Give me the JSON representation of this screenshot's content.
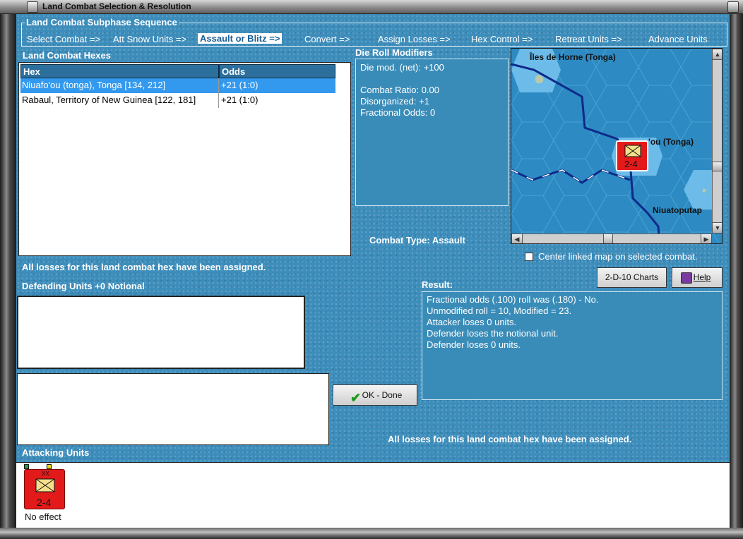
{
  "window": {
    "title": "Land Combat Selection & Resolution"
  },
  "subphase": {
    "title": "Land Combat Subphase Sequence",
    "steps": [
      "Select Combat =>",
      "Att Snow Units =>",
      "Assault or Blitz =>",
      "Convert =>",
      "Assign Losses =>",
      "Hex Control =>",
      "Retreat Units =>",
      "Advance Units"
    ],
    "active_step": "Assault or Blitz =>"
  },
  "hexes": {
    "title": "Land Combat Hexes",
    "columns": [
      "Hex",
      "Odds"
    ],
    "rows": [
      {
        "hex": "Niuafo'ou (tonga), Tonga [134, 212]",
        "odds": "+21 (1:0)",
        "selected": true
      },
      {
        "hex": "Rabaul, Territory of New Guinea [122, 181]",
        "odds": "+21 (1:0)",
        "selected": false
      }
    ]
  },
  "die_roll": {
    "title": "Die Roll Modifiers",
    "net": "Die mod. (net): +100",
    "lines": [
      "Combat Ratio: 0.00",
      "Disorganized: +1",
      "Fractional Odds: 0"
    ]
  },
  "combat_type": "Combat Type:  Assault",
  "map": {
    "labels": [
      "Îles de Horne (Tonga)",
      "'ou (Tonga)",
      "Niuatoputap"
    ],
    "unit_strength": "2-4",
    "center_label": "Center linked map on selected combat.",
    "center_checked": false
  },
  "losses_assigned_text": "All losses for this land combat hex have been assigned.",
  "defending_units": {
    "title": "Defending Units +0 Notional"
  },
  "buttons": {
    "charts": "2-D-10 Charts",
    "help": "Help",
    "ok": "OK - Done"
  },
  "result": {
    "title": "Result:",
    "lines": [
      "Fractional odds (.100) roll was (.180)  - No.",
      "Unmodified roll = 10, Modified = 23.",
      "Attacker loses 0 units.",
      "Defender loses the notional unit.",
      "Defender loses 0 units."
    ]
  },
  "bottom_message": "All losses for this land combat hex have been assigned.",
  "attacking_units": {
    "title": "Attacking Units",
    "units": [
      {
        "strength": "2-4",
        "size": "XX",
        "status": "No effect"
      }
    ]
  },
  "colors": {
    "panel_blue": "#3d8dbb",
    "selected_row": "#3399ee",
    "unit_red": "#e21a1a"
  }
}
